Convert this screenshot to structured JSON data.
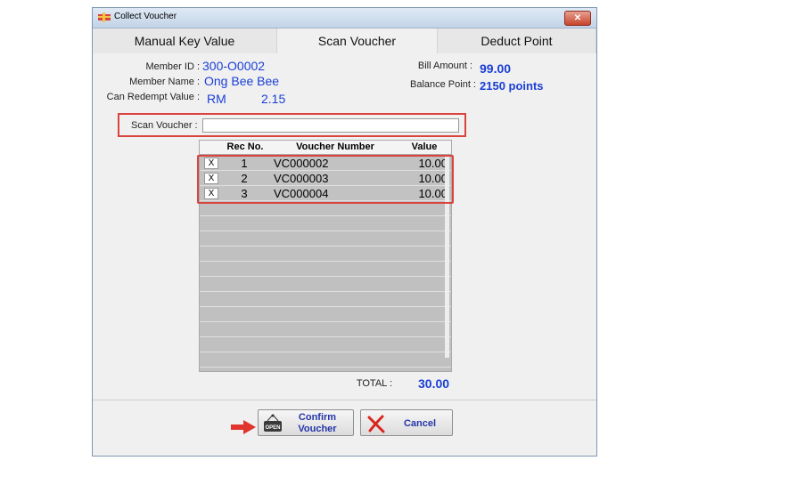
{
  "window": {
    "title": "Collect Voucher",
    "close_label": "✕"
  },
  "tabs": [
    {
      "label": "Manual Key Value"
    },
    {
      "label": "Scan Voucher"
    },
    {
      "label": "Deduct Point"
    }
  ],
  "member": {
    "id_label": "Member ID :",
    "id_value": "300-O0002",
    "name_label": "Member Name :",
    "name_value": "Ong Bee Bee",
    "redempt_label": "Can Redempt Value :",
    "redempt_currency": "RM",
    "redempt_value": "2.15"
  },
  "bill": {
    "amount_label": "Bill Amount :",
    "amount_value": "99.00",
    "balance_label": "Balance Point :",
    "balance_value": "2150 points"
  },
  "scan": {
    "label": "Scan Voucher :",
    "value": ""
  },
  "table": {
    "headers": {
      "rec": "Rec No.",
      "voucher": "Voucher Number",
      "value": "Value"
    },
    "rows": [
      {
        "x": "X",
        "rec": "1",
        "voucher": "VC000002",
        "value": "10.00"
      },
      {
        "x": "X",
        "rec": "2",
        "voucher": "VC000003",
        "value": "10.00"
      },
      {
        "x": "X",
        "rec": "3",
        "voucher": "VC000004",
        "value": "10.00"
      }
    ]
  },
  "total": {
    "label": "TOTAL :",
    "value": "30.00"
  },
  "buttons": {
    "confirm_line1": "Confirm",
    "confirm_line2": "Voucher",
    "confirm_icon_text": "OPEN",
    "cancel": "Cancel"
  },
  "colors": {
    "accent": "#1a3fd6",
    "highlight": "#d9443e"
  }
}
